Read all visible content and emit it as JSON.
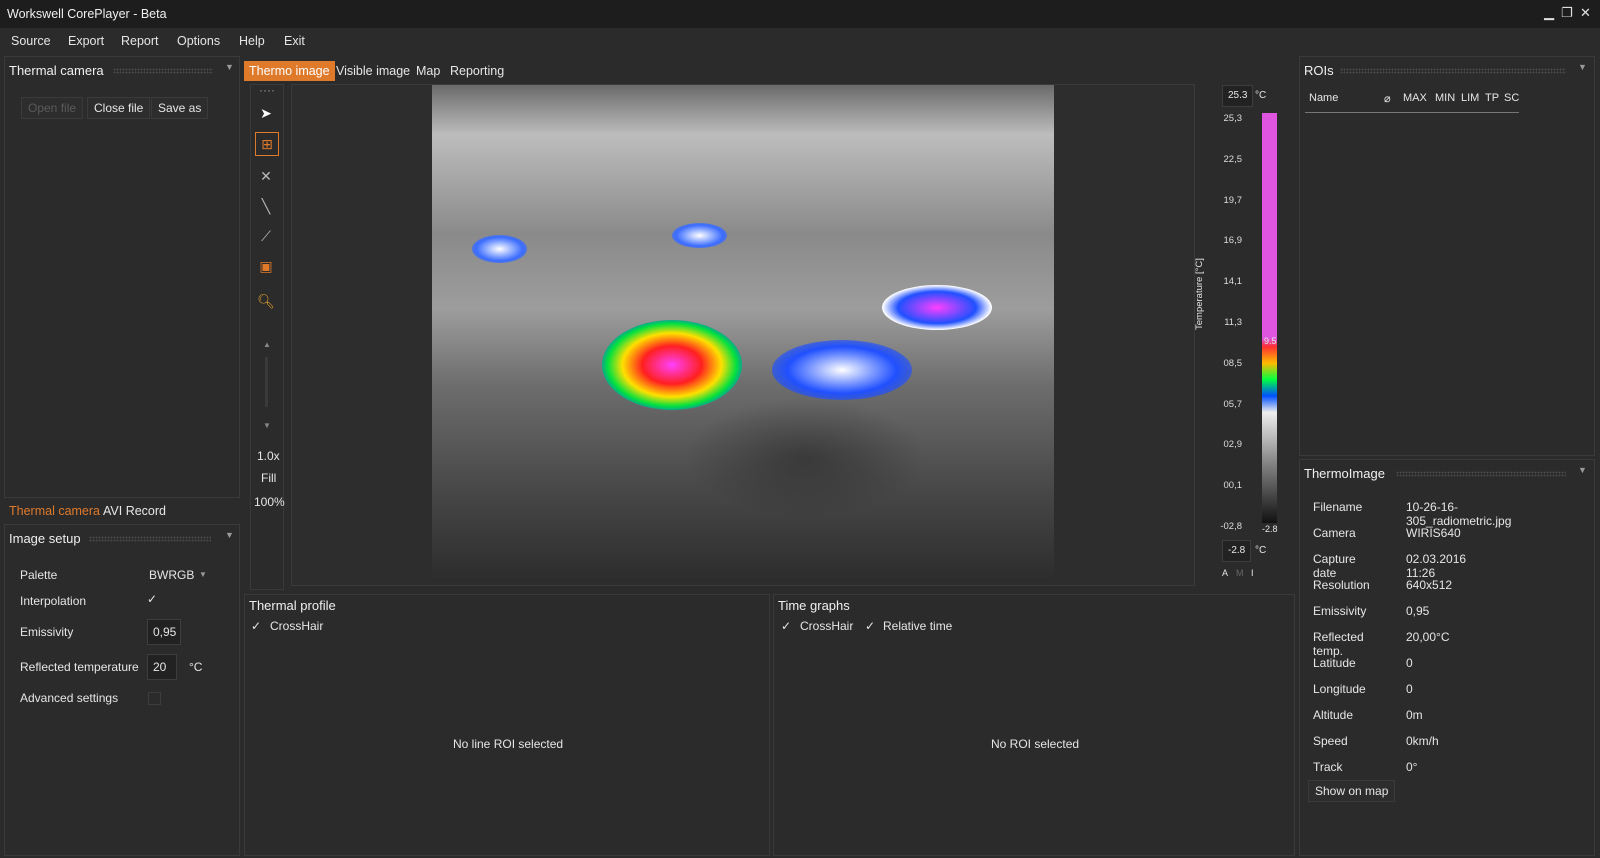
{
  "window": {
    "title": "Workswell CorePlayer - Beta",
    "controls": [
      "minimize-icon",
      "restore-icon",
      "close-icon"
    ]
  },
  "menu": [
    "Source",
    "Export",
    "Report",
    "Options",
    "Help",
    "Exit"
  ],
  "left": {
    "thermal_camera": {
      "title": "Thermal camera",
      "buttons": {
        "open": "Open file",
        "close": "Close file",
        "save": "Save as"
      },
      "tabs": [
        "Thermal camera",
        "AVI Record"
      ]
    },
    "image_setup": {
      "title": "Image setup",
      "palette_label": "Palette",
      "palette_value": "BWRGB",
      "interpolation_label": "Interpolation",
      "interpolation_check": "✓",
      "emissivity_label": "Emissivity",
      "emissivity_value": "0,95",
      "reflected_label": "Reflected temperature",
      "reflected_value": "20",
      "reflected_unit": "°C",
      "advanced_label": "Advanced settings"
    }
  },
  "center": {
    "tabs": [
      "Thermo image",
      "Visible image",
      "Map",
      "Reporting"
    ],
    "zoom": "1.0x",
    "fill": "Fill",
    "percent": "100%",
    "scale": {
      "max_box": "25.3",
      "min_box": "-2.8",
      "unit": "°C",
      "axis_label": "Temperature [°C]",
      "ticks": [
        "25,3",
        "22,5",
        "19,7",
        "16,9",
        "14,1",
        "11,3",
        "08,5",
        "05,7",
        "02,9",
        "00,1",
        "-02,8"
      ],
      "upper_marker": "9.5",
      "lower_marker": "-2.8",
      "modes": [
        "A",
        "M",
        "I"
      ]
    }
  },
  "thermal_profile": {
    "title": "Thermal profile",
    "check": "CrossHair",
    "empty": "No line ROI selected"
  },
  "time_graphs": {
    "title": "Time graphs",
    "check1": "CrossHair",
    "check2": "Relative time",
    "empty": "No ROI selected"
  },
  "rois": {
    "title": "ROIs",
    "columns": [
      "Name",
      "⌀",
      "MAX",
      "MIN",
      "LIM",
      "TP",
      "SC"
    ]
  },
  "thermo_image": {
    "title": "ThermoImage",
    "rows": [
      {
        "k": "Filename",
        "v": "10-26-16-305_radiometric.jpg"
      },
      {
        "k": "Camera",
        "v": "WIRIS640"
      },
      {
        "k": "Capture date",
        "v": "02.03.2016 11:26"
      },
      {
        "k": "Resolution",
        "v": "640x512"
      },
      {
        "k": "Emissivity",
        "v": "0,95"
      },
      {
        "k": "Reflected temp.",
        "v": "20,00°C"
      },
      {
        "k": "Latitude",
        "v": "0"
      },
      {
        "k": "Longitude",
        "v": "0"
      },
      {
        "k": "Altitude",
        "v": "0m"
      },
      {
        "k": "Speed",
        "v": "0km/h"
      },
      {
        "k": "Track",
        "v": "0°"
      }
    ],
    "show_map": "Show on map"
  },
  "colors": {
    "accent": "#e07a2b",
    "background": "#2b2b2b"
  }
}
